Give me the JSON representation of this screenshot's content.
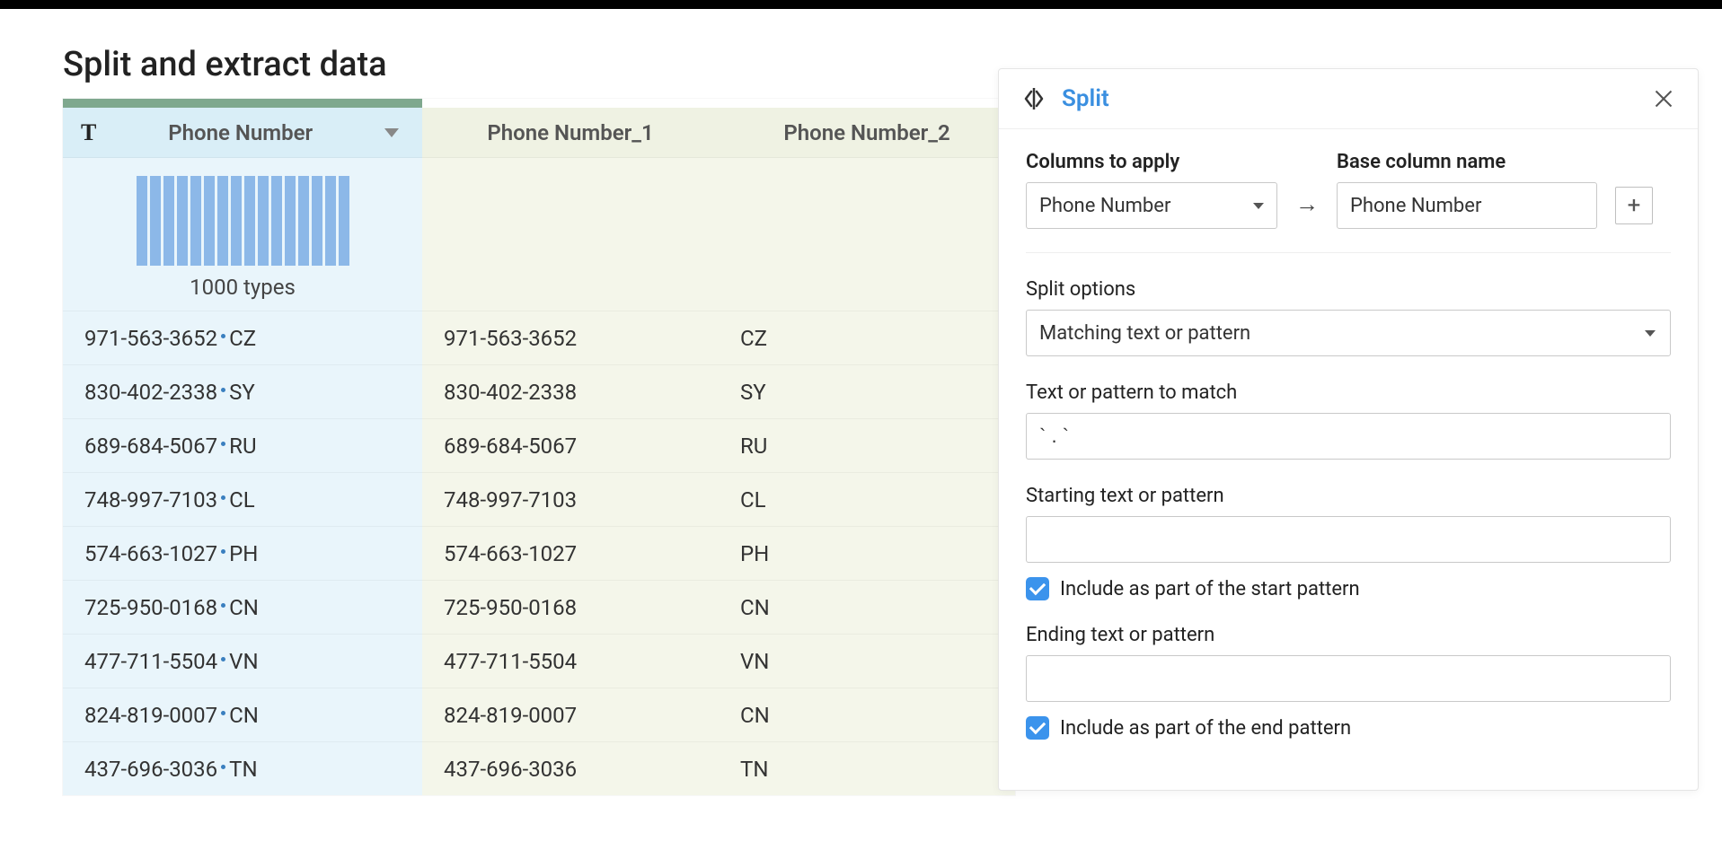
{
  "page_title": "Split and extract data",
  "table": {
    "columns": [
      {
        "label": "Phone Number"
      },
      {
        "label": "Phone Number_1"
      },
      {
        "label": "Phone Number_2"
      }
    ],
    "histogram_caption": "1000 types",
    "rows": [
      {
        "orig_left": "971-563-3652",
        "orig_right": "CZ",
        "c1": "971-563-3652",
        "c2": "CZ"
      },
      {
        "orig_left": "830-402-2338",
        "orig_right": "SY",
        "c1": "830-402-2338",
        "c2": "SY"
      },
      {
        "orig_left": "689-684-5067",
        "orig_right": "RU",
        "c1": "689-684-5067",
        "c2": "RU"
      },
      {
        "orig_left": "748-997-7103",
        "orig_right": "CL",
        "c1": "748-997-7103",
        "c2": "CL"
      },
      {
        "orig_left": "574-663-1027",
        "orig_right": "PH",
        "c1": "574-663-1027",
        "c2": "PH"
      },
      {
        "orig_left": "725-950-0168",
        "orig_right": "CN",
        "c1": "725-950-0168",
        "c2": "CN"
      },
      {
        "orig_left": "477-711-5504",
        "orig_right": "VN",
        "c1": "477-711-5504",
        "c2": "VN"
      },
      {
        "orig_left": "824-819-0007",
        "orig_right": "CN",
        "c1": "824-819-0007",
        "c2": "CN"
      },
      {
        "orig_left": "437-696-3036",
        "orig_right": "TN",
        "c1": "437-696-3036",
        "c2": "TN"
      }
    ]
  },
  "panel": {
    "title": "Split",
    "columns_to_apply_label": "Columns to apply",
    "columns_to_apply_value": "Phone Number",
    "base_col_label": "Base column name",
    "base_col_value": "Phone Number",
    "split_options_label": "Split options",
    "split_options_value": "Matching text or pattern",
    "pattern_label": "Text or pattern to match",
    "pattern_value": "` . `",
    "start_label": "Starting text or pattern",
    "start_value": "",
    "start_checkbox_label": "Include as part of the start pattern",
    "end_label": "Ending text or pattern",
    "end_value": "",
    "end_checkbox_label": "Include as part of the end pattern"
  }
}
